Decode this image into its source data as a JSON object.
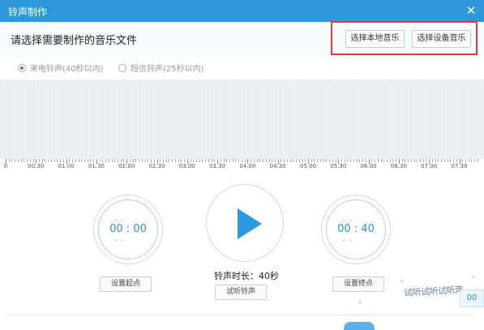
{
  "window": {
    "title": "铃声制作",
    "close_glyph": "✕"
  },
  "header": {
    "title": "请选择需要制作的音乐文件"
  },
  "buttons": {
    "local_music": "选择本地音乐",
    "device_music": "选择设备音乐"
  },
  "ringtone_types": [
    {
      "label": "来电铃声(40秒以内)",
      "selected": true
    },
    {
      "label": "短信铃声(25秒以内)",
      "selected": false
    }
  ],
  "timeline": {
    "labels": [
      "0",
      "00.30",
      "01.00",
      "01.30",
      "02.00",
      "02.30",
      "03.00",
      "03.30",
      "04.00",
      "04.30",
      "05.00",
      "05.30",
      "06.00",
      "06.30",
      "07.00",
      "07.30"
    ]
  },
  "start_time": "00 : 00",
  "end_time": "00 : 40",
  "duration_text": "铃声时长：40秒",
  "actions": {
    "set_start": "设置起点",
    "listen": "试听铃声",
    "set_end": "设置终点"
  },
  "overlay": {
    "text": "试听试听试听声",
    "corner_text": "00"
  },
  "colors": {
    "accent": "#2f98db",
    "highlight": "#e23b3b"
  }
}
